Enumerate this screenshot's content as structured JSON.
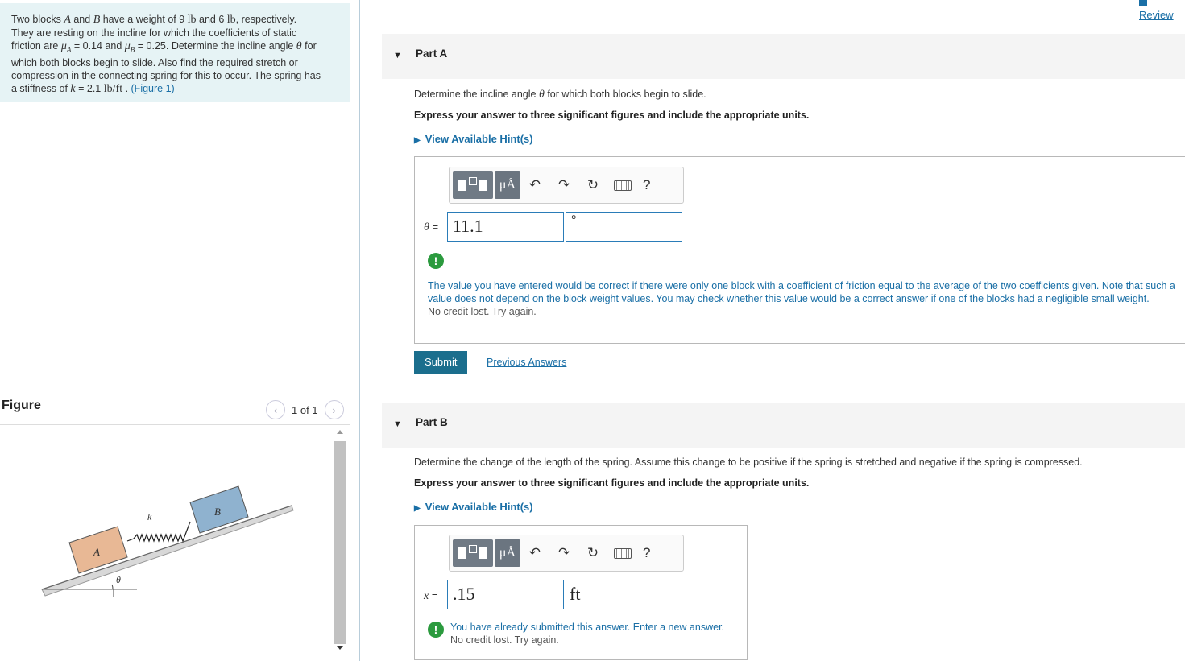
{
  "problem": {
    "text_1": "Two blocks ",
    "A": "A",
    "text_2": " and ",
    "B": "B",
    "text_3": " have a weight of 9 ",
    "lb": "lb",
    "text_4": " and 6 ",
    "text_5": ", respectively.",
    "line2": "They are resting on the incline for which the coefficients of static",
    "line3a": "friction are ",
    "muA": "μ",
    "subA": "A",
    "line3b": " = 0.14 and ",
    "muB": "μ",
    "subB": "B",
    "line3c": " = 0.25. Determine the incline angle ",
    "theta": "θ",
    "line3d": " for",
    "line4": "which both blocks begin to slide. Also find the required stretch or",
    "line5": "compression in the connecting spring for this to occur. The spring has",
    "line6a": "a stiffness of ",
    "k": "k",
    "line6b": " = 2.1 ",
    "kunit": "lb/ft",
    "line6c": " . ",
    "figure_link": "(Figure 1)"
  },
  "figure": {
    "title": "Figure",
    "pager": "1 of 1",
    "labels": {
      "A": "A",
      "B": "B",
      "k": "k",
      "theta": "θ"
    }
  },
  "header": {
    "review": "Review"
  },
  "partA": {
    "label": "Part A",
    "question_a": "Determine the incline angle ",
    "question_theta": "θ",
    "question_b": " for which both blocks begin to slide.",
    "instruction": "Express your answer to three significant figures and include the appropriate units.",
    "hint": "View Available Hint(s)",
    "var_label": "θ",
    "var_eq": " =",
    "value": "11.1",
    "unit": "°",
    "feedback": "The value you have entered would be correct if there were only one block with a coefficient of friction equal to the average of the two coefficients given. Note that such a value does not depend on the block weight values. You may check whether this value would be a correct answer if one of the blocks had a negligible small weight.",
    "credit": "No credit lost. Try again.",
    "submit": "Submit",
    "previous": "Previous Answers"
  },
  "partB": {
    "label": "Part B",
    "question": "Determine the change of the length of  the spring. Assume this change to be positive if the spring is stretched and negative if the spring is compressed.",
    "instruction": "Express your answer to three significant figures and include the appropriate units.",
    "hint": "View Available Hint(s)",
    "var_label": "x",
    "var_eq": " =",
    "value": ".15",
    "unit": "ft",
    "feedback": "You have already submitted this answer. Enter a new answer.",
    "credit": "No credit lost. Try again."
  },
  "toolbar": {
    "mu_label": "μÅ",
    "help": "?"
  },
  "colors": {
    "accent": "#1a6fa6",
    "submit": "#1b6e8d",
    "warning": "#2b9a3e",
    "problem_bg": "#e6f3f5"
  }
}
